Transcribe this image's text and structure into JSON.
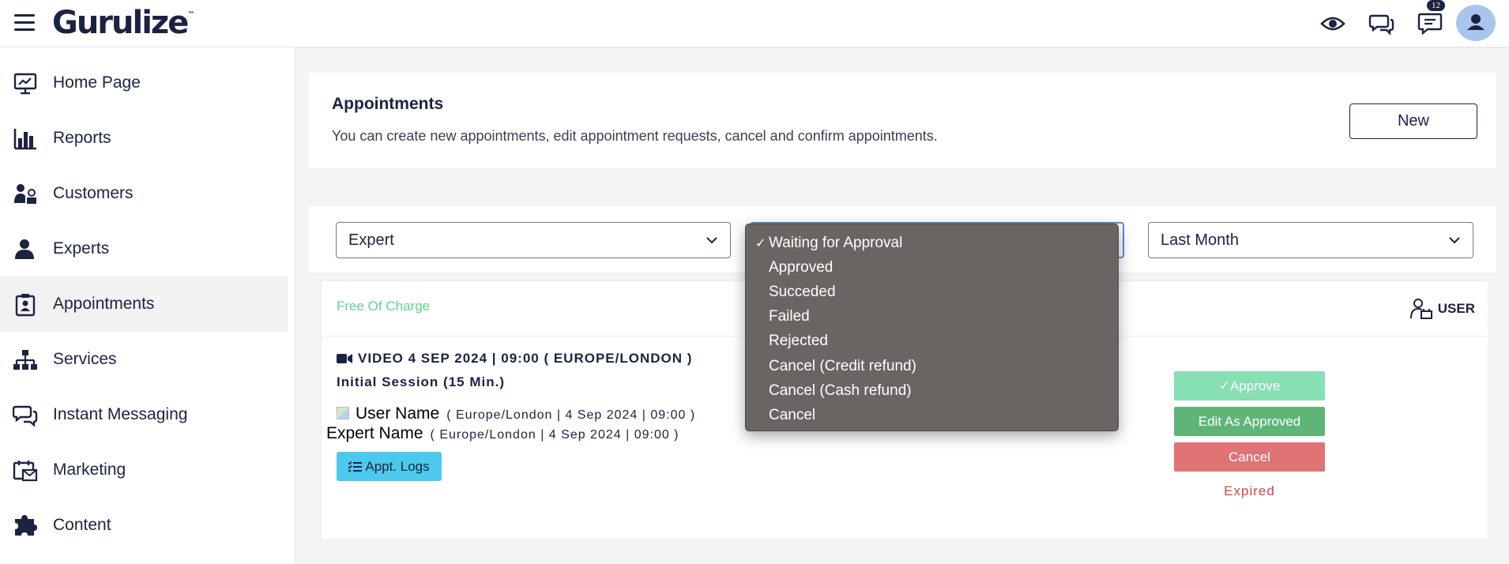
{
  "header": {
    "logo_text": "Gurulize",
    "logo_tm": "™",
    "notification_count": "12"
  },
  "sidebar": {
    "items": [
      {
        "label": "Home Page",
        "icon": "monitor-chart-icon"
      },
      {
        "label": "Reports",
        "icon": "bar-chart-icon"
      },
      {
        "label": "Customers",
        "icon": "customers-icon"
      },
      {
        "label": "Experts",
        "icon": "user-icon"
      },
      {
        "label": "Appointments",
        "icon": "clipboard-user-icon",
        "active": true
      },
      {
        "label": "Services",
        "icon": "sitemap-icon"
      },
      {
        "label": "Instant Messaging",
        "icon": "chat-bubbles-icon"
      },
      {
        "label": "Marketing",
        "icon": "calendar-mail-icon"
      },
      {
        "label": "Content",
        "icon": "puzzle-icon"
      }
    ]
  },
  "page": {
    "title": "Appointments",
    "description": "You can create new appointments, edit appointment requests, cancel and confirm appointments.",
    "new_label": "New"
  },
  "filters": {
    "expert": "Expert",
    "period": "Last Month"
  },
  "status_dropdown": {
    "selected_check": "✓",
    "options": [
      "Waiting for Approval",
      "Approved",
      "Succeded",
      "Failed",
      "Rejected",
      "Cancel (Credit refund)",
      "Cancel (Cash refund)",
      "Cancel"
    ]
  },
  "appointment": {
    "pricing": "Free Of Charge",
    "role_tag": "USER",
    "line1": "VIDEO 4 SEP 2024 | 09:00 ( EUROPE/LONDON )",
    "line2": "Initial Session (15 Min.)",
    "user_name": "User Name",
    "user_meta": "( Europe/London | 4 Sep 2024 | 09:00 )",
    "expert_name": "Expert Name",
    "expert_meta": "( Europe/London | 4 Sep 2024 | 09:00 )",
    "logs_label": "Appt. Logs",
    "approve_label": "✓Approve",
    "edit_label": "Edit As Approved",
    "cancel_label": "Cancel",
    "status_text": "Expired"
  },
  "colors": {
    "brand_navy": "#1b2340",
    "approve": "#86e0b3",
    "edit": "#5fb578",
    "cancel": "#e07373",
    "logs": "#4cc9ec",
    "free": "#5fd394",
    "expired": "#d2444a",
    "dropdown_bg": "#6a6563"
  }
}
